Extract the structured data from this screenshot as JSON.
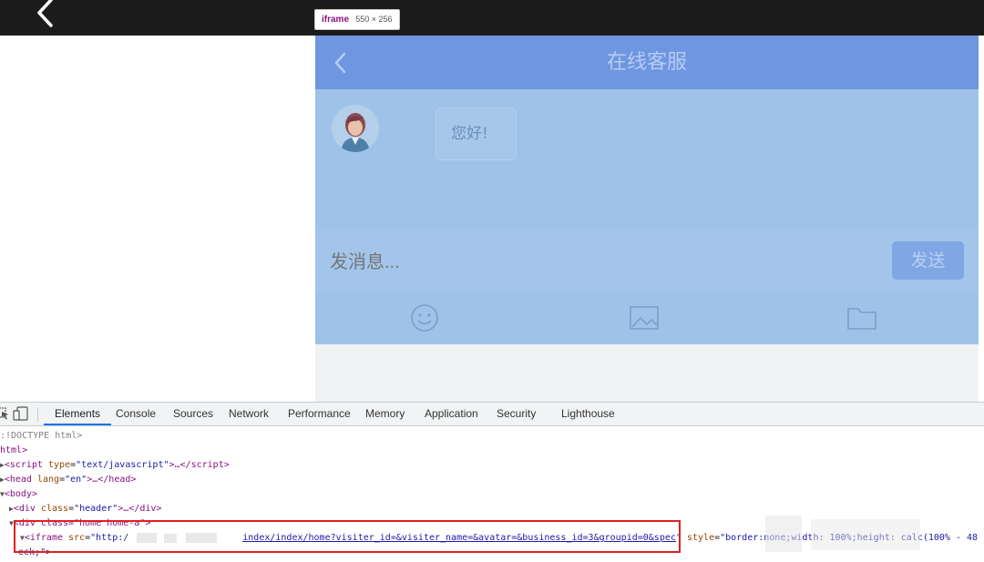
{
  "app_bar": {
    "back_icon": "chevron-left-icon"
  },
  "tooltip": {
    "tag": "iframe",
    "dims": "550 × 256"
  },
  "chat": {
    "title": "在线客服",
    "greeting": "您好!",
    "input_placeholder": "发消息...",
    "send_label": "发送",
    "tools": [
      "emoji-icon",
      "image-icon",
      "folder-icon"
    ],
    "colors": {
      "header": "#6e96e1",
      "body": "#9fc3e8",
      "send": "#7ea7e4"
    }
  },
  "devtools": {
    "tabs": [
      "Elements",
      "Console",
      "Sources",
      "Network",
      "Performance",
      "Memory",
      "Application",
      "Security",
      "Lighthouse"
    ],
    "active_tab": "Elements",
    "dom": {
      "doctype": ":!DOCTYPE html>",
      "html_open": "html>",
      "script_tag": "script",
      "script_attr": "type",
      "script_val": "\"text/javascript\"",
      "script_rest": ">…</",
      "script_close": "script>",
      "head_tag": "head",
      "head_attr": "lang",
      "head_val": "\"en\"",
      "head_rest": ">…</",
      "head_close": "head>",
      "body_open": "body>",
      "div_tag": "div",
      "div_attr": "class",
      "div_val": "\"header\"",
      "div_rest": ">…</",
      "div_close": "div>",
      "div2_text": "div class=\"home home-a\">",
      "iframe_tag": "iframe",
      "iframe_attr": "src",
      "iframe_src_prefix": "\"http:/",
      "iframe_src_path": "index/index/home?visiter_id=&visiter_name=&avatar=&business_id=3&groupid=0&spec",
      "iframe_src_end": "\"",
      "style_attr": "style",
      "style_val": "\"border:none;width: 100%;height: calc(100% - 48",
      "iframe_cont": "eck;\">"
    }
  }
}
